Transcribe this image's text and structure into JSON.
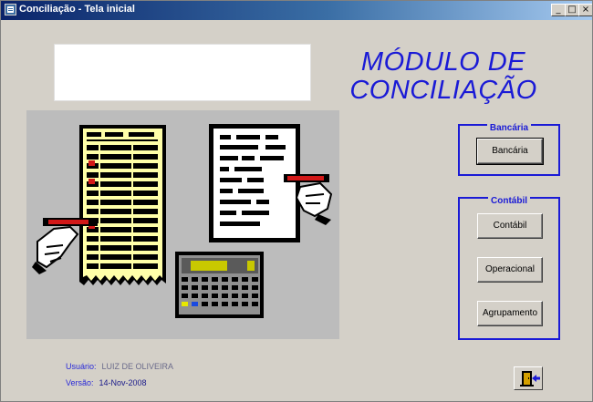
{
  "window": {
    "title": "Conciliação - Tela inicial",
    "controls": {
      "minimize": "_",
      "restore": "□",
      "close": "×"
    }
  },
  "main_title_line1": "MÓDULO DE",
  "main_title_line2": "CONCILIAÇÃO",
  "bancaria_group": {
    "legend": "Bancária",
    "buttons": [
      "Bancária"
    ]
  },
  "contabil_group": {
    "legend": "Contábil",
    "buttons": [
      "Contábil",
      "Operacional",
      "Agrupamento"
    ]
  },
  "user": {
    "label": "Usuário:",
    "value": "LUIZ  DE OLIVEIRA"
  },
  "version": {
    "label": "Versão:",
    "value": "14-Nov-2008"
  },
  "icons": {
    "app": "app-icon",
    "exit": "exit-door-icon",
    "illustration": "ledger-document-calculator-illustration"
  },
  "colors": {
    "accent_blue": "#1a1ad6",
    "titlebar_start": "#0a246a",
    "titlebar_end": "#a6caf0",
    "window_bg": "#d4d0c8"
  }
}
